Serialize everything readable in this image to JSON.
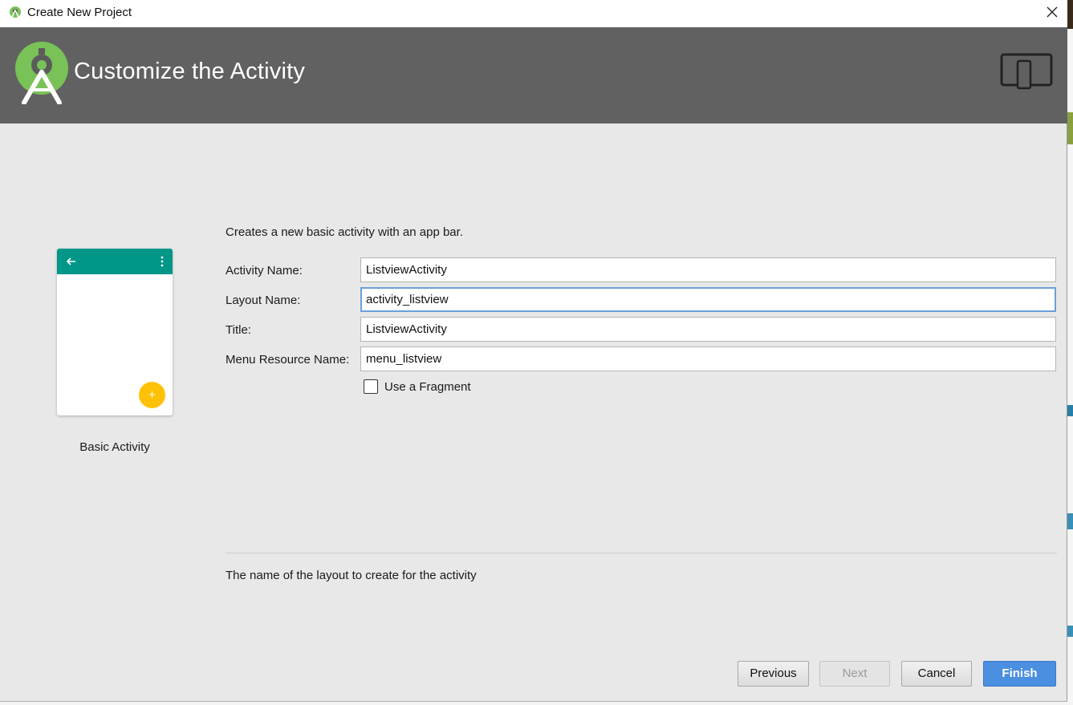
{
  "window": {
    "title": "Create New Project"
  },
  "banner": {
    "heading": "Customize the Activity",
    "logo_icon": "android-studio-logo-icon",
    "device_icon": "tablet-phone-icon"
  },
  "template": {
    "name": "Basic Activity",
    "appbar_color": "#009688",
    "fab_color": "#ffc107",
    "fab_symbol": "+"
  },
  "form": {
    "description": "Creates a new basic activity with an app bar.",
    "fields": [
      {
        "label": "Activity Name:",
        "value": "ListviewActivity"
      },
      {
        "label": "Layout Name:",
        "value": "activity_listview"
      },
      {
        "label": "Title:",
        "value": "ListviewActivity"
      },
      {
        "label": "Menu Resource Name:",
        "value": "menu_listview"
      }
    ],
    "fragment_checkbox": {
      "label": "Use a Fragment",
      "checked": false
    }
  },
  "help_text": "The name of the layout to create for the activity",
  "buttons": {
    "previous": "Previous",
    "next": "Next",
    "cancel": "Cancel",
    "finish": "Finish"
  },
  "colors": {
    "banner_background": "#616161",
    "primary_button": "#4a8fe0",
    "focus_border": "#6aa0d8"
  }
}
